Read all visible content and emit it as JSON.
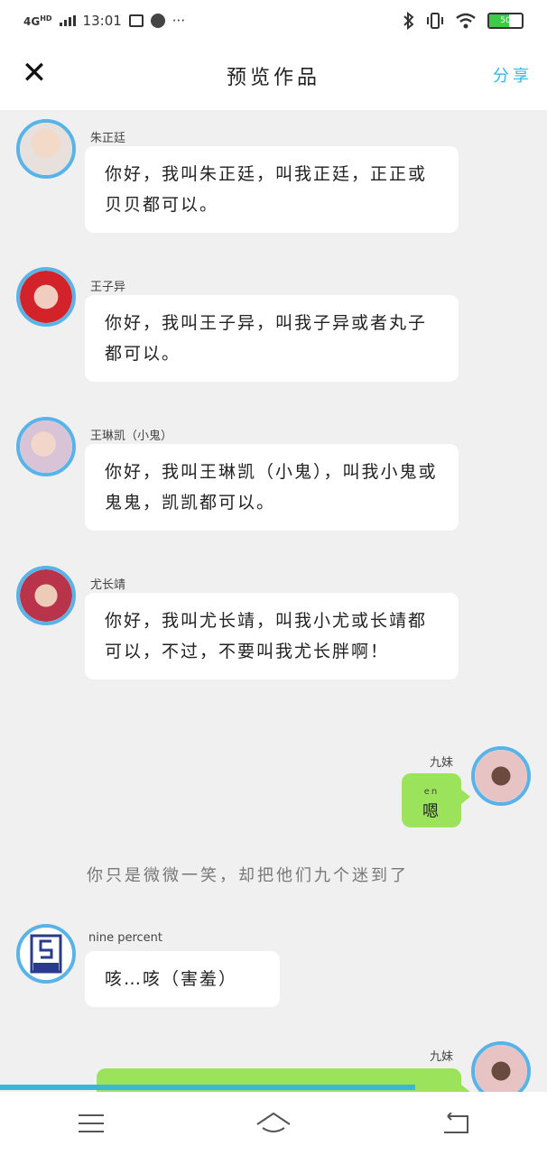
{
  "status_bar": {
    "network": "4G",
    "network_suffix": "HD",
    "time": "13:01",
    "more": "···",
    "battery_level": "50",
    "icons": [
      "signal-icon",
      "calendar-icon",
      "app-icon",
      "bluetooth-icon",
      "vibrate-icon",
      "wifi-icon",
      "battery-icon"
    ]
  },
  "header": {
    "close_label": "✕",
    "title": "预览作品",
    "share_label": "分享"
  },
  "messages": [
    {
      "name": "朱正廷",
      "text": "你好，我叫朱正廷，叫我正廷，正正或贝贝都可以。"
    },
    {
      "name": "王子异",
      "text": "你好，我叫王子异，叫我子异或者丸子都可以。"
    },
    {
      "name": "王琳凯（小鬼）",
      "text": "你好，我叫王琳凯（小鬼），叫我小鬼或鬼鬼，凯凯都可以。"
    },
    {
      "name": "尤长靖",
      "text": "你好，我叫尤长靖，叫我小尤或长靖都可以，不过，不要叫我尤长胖啊！"
    },
    {
      "name": "九妹",
      "text": "嗯",
      "pinyin": "en"
    },
    {
      "name": "nine percent",
      "text": "咳…咳（害羞）"
    },
    {
      "name": "九妹"
    }
  ],
  "narration": "你只是微微一笑，却把他们九个迷到了",
  "colors": {
    "accent": "#2fb7e6",
    "my_bubble": "#9be35a",
    "avatar_border": "#58b4e8",
    "background": "#f0f0f0"
  }
}
